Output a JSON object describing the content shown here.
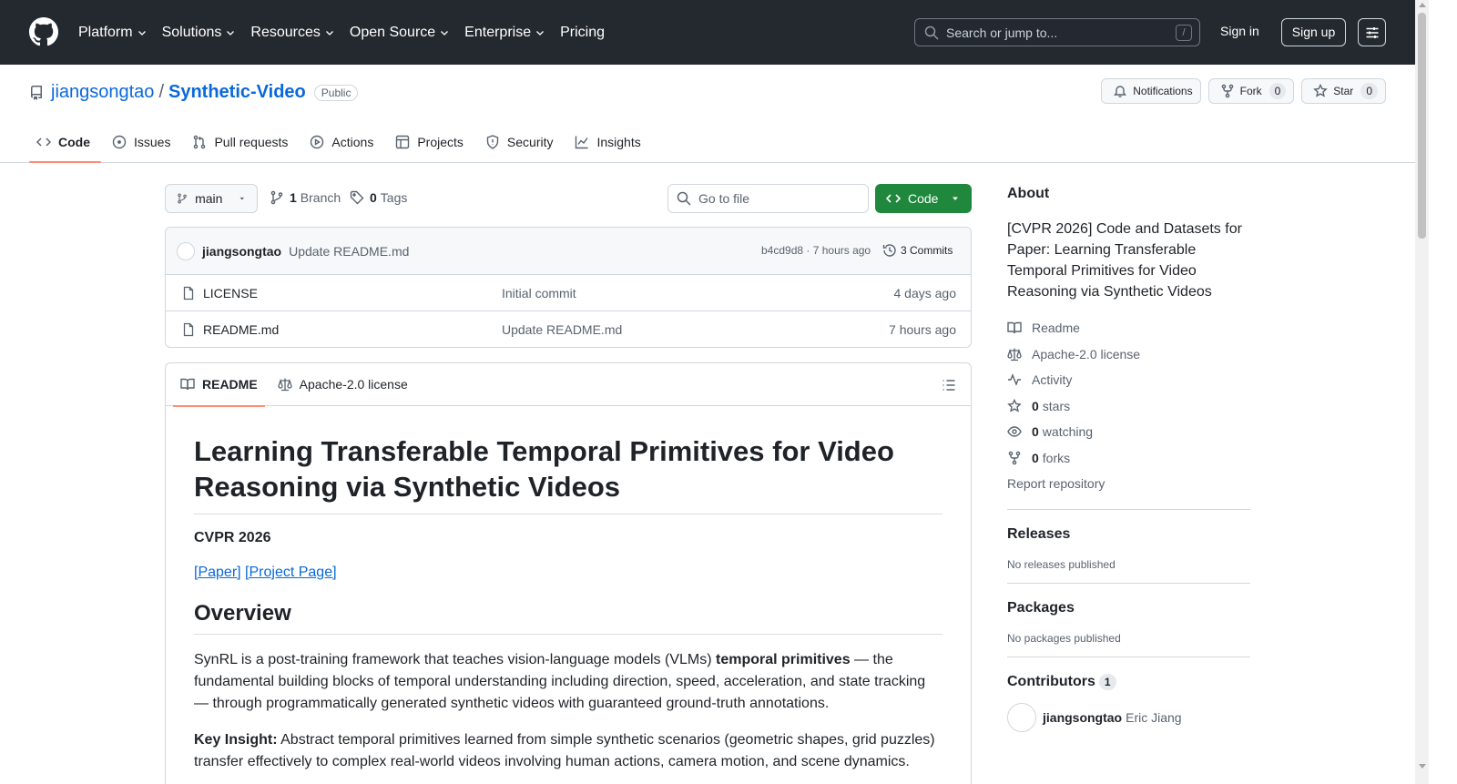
{
  "header": {
    "nav": [
      {
        "label": "Platform",
        "dropdown": true
      },
      {
        "label": "Solutions",
        "dropdown": true
      },
      {
        "label": "Resources",
        "dropdown": true
      },
      {
        "label": "Open Source",
        "dropdown": true
      },
      {
        "label": "Enterprise",
        "dropdown": true
      },
      {
        "label": "Pricing",
        "dropdown": false
      }
    ],
    "search_placeholder": "Search or jump to...",
    "search_shortcut": "/",
    "sign_in": "Sign in",
    "sign_up": "Sign up"
  },
  "repo": {
    "owner": "jiangsongtao",
    "separator": "/",
    "name": "Synthetic-Video",
    "visibility": "Public",
    "notifications_label": "Notifications",
    "fork_label": "Fork",
    "fork_count": "0",
    "star_label": "Star",
    "star_count": "0",
    "tabs": [
      {
        "label": "Code",
        "icon": "code-icon",
        "active": true
      },
      {
        "label": "Issues",
        "icon": "issue-icon",
        "active": false
      },
      {
        "label": "Pull requests",
        "icon": "pull-request-icon",
        "active": false
      },
      {
        "label": "Actions",
        "icon": "play-icon",
        "active": false
      },
      {
        "label": "Projects",
        "icon": "table-icon",
        "active": false
      },
      {
        "label": "Security",
        "icon": "shield-icon",
        "active": false
      },
      {
        "label": "Insights",
        "icon": "graph-icon",
        "active": false
      }
    ]
  },
  "toolbar": {
    "branch": "main",
    "branch_count": "1",
    "branch_label": "Branch",
    "tag_count": "0",
    "tag_label": "Tags",
    "go_to_file": "Go to file",
    "code_button": "Code"
  },
  "latest_commit": {
    "author": "jiangsongtao",
    "message": "Update README.md",
    "sha_time": "b4cd9d8 · 7 hours ago",
    "commits": "3 Commits"
  },
  "files": [
    {
      "name": "LICENSE",
      "message": "Initial commit",
      "age": "4 days ago"
    },
    {
      "name": "README.md",
      "message": "Update README.md",
      "age": "7 hours ago"
    }
  ],
  "readme": {
    "tab_readme": "README",
    "tab_license": "Apache-2.0 license",
    "title": "Learning Transferable Temporal Primitives for Video Reasoning via Synthetic Videos",
    "venue": "CVPR 2026",
    "link_paper": "[Paper]",
    "link_project": "[Project Page]",
    "overview_heading": "Overview",
    "overview_before_bold": "SynRL is a post-training framework that teaches vision-language models (VLMs) ",
    "overview_bold": "temporal primitives",
    "overview_after_bold": " — the fundamental building blocks of temporal understanding including direction, speed, acceleration, and state tracking — through programmatically generated synthetic videos with guaranteed ground-truth annotations.",
    "insight_label": "Key Insight:",
    "insight_text": " Abstract temporal primitives learned from simple synthetic scenarios (geometric shapes, grid puzzles) transfer effectively to complex real-world videos involving human actions, camera motion, and scene dynamics."
  },
  "sidebar": {
    "about_heading": "About",
    "description": "[CVPR 2026] Code and Datasets for Paper: Learning Transferable Temporal Primitives for Video Reasoning via Synthetic Videos",
    "readme": "Readme",
    "license": "Apache-2.0 license",
    "activity": "Activity",
    "stars_count": "0",
    "stars_label": "stars",
    "watching_count": "0",
    "watching_label": "watching",
    "forks_count": "0",
    "forks_label": "forks",
    "report": "Report repository",
    "releases_heading": "Releases",
    "releases_empty": "No releases published",
    "packages_heading": "Packages",
    "packages_empty": "No packages published",
    "contributors_heading": "Contributors",
    "contributors_count": "1",
    "contributor_login": "jiangsongtao",
    "contributor_name": "Eric Jiang"
  },
  "colors": {
    "header_bg": "#24292f",
    "link": "#0969da",
    "primary_button": "#1f883d",
    "active_tab_underline": "#fd8c73"
  }
}
